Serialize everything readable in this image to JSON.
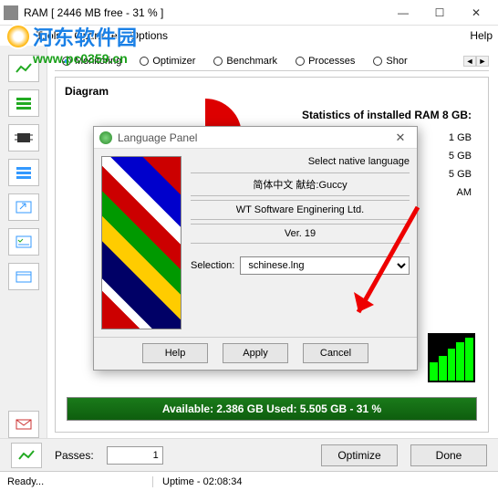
{
  "window": {
    "title": "RAM [ 2446 MB free - 31 % ]",
    "min": "—",
    "max": "☐",
    "close": "✕"
  },
  "menu": {
    "file": "File",
    "tools": "Tools",
    "optimize": "Optimize",
    "options": "Options",
    "help": "Help"
  },
  "watermark": {
    "cn": "河东软件园",
    "url": "www.pc0359.cn"
  },
  "tabs": {
    "monitoring": "Monitoring",
    "optimizer": "Optimizer",
    "benchmark": "Benchmark",
    "processes": "Processes",
    "short": "Shor"
  },
  "diagram": {
    "label": "Diagram"
  },
  "stats": {
    "title": "Statistics of installed RAM 8 GB:",
    "r1": "1 GB",
    "r2": "5 GB",
    "r3": "5 GB",
    "r4": "AM"
  },
  "available_bar": "Available: 2.386 GB  Used: 5.505 GB - 31 %",
  "bottom": {
    "passes": "Passes:",
    "passes_val": "1",
    "optimize": "Optimize",
    "done": "Done"
  },
  "status": {
    "ready": "Ready...",
    "uptime": "Uptime - 02:08:34"
  },
  "dialog": {
    "title": "Language Panel",
    "hint": "Select native language",
    "line1": "简体中文  献给:Guccy",
    "line2": "WT Software Enginering Ltd.",
    "line3": "Ver. 19",
    "selection_label": "Selection:",
    "selection_value": "schinese.lng",
    "help": "Help",
    "apply": "Apply",
    "cancel": "Cancel"
  }
}
